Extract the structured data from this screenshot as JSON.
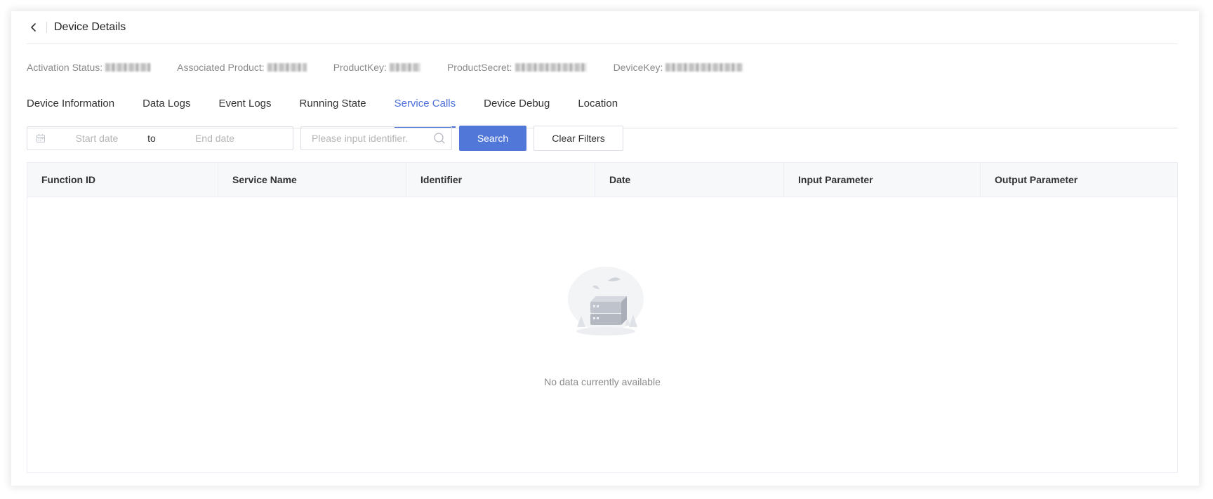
{
  "header": {
    "title": "Device Details"
  },
  "props": [
    {
      "label": "Activation Status:"
    },
    {
      "label": "Associated Product:"
    },
    {
      "label": "ProductKey:"
    },
    {
      "label": "ProductSecret:"
    },
    {
      "label": "DeviceKey:"
    }
  ],
  "tabs": [
    {
      "label": "Device Information",
      "active": false
    },
    {
      "label": "Data Logs",
      "active": false
    },
    {
      "label": "Event Logs",
      "active": false
    },
    {
      "label": "Running State",
      "active": false
    },
    {
      "label": "Service Calls",
      "active": true
    },
    {
      "label": "Device Debug",
      "active": false
    },
    {
      "label": "Location",
      "active": false
    }
  ],
  "filters": {
    "start_placeholder": "Start date",
    "range_separator": "to",
    "end_placeholder": "End date",
    "identifier_placeholder": "Please input identifier.",
    "search_label": "Search",
    "clear_label": "Clear Filters"
  },
  "table": {
    "columns": [
      "Function ID",
      "Service Name",
      "Identifier",
      "Date",
      "Input Parameter",
      "Output Parameter"
    ],
    "empty_text": "No data currently available"
  },
  "icons": {
    "back": "chevron-left-icon",
    "calendar": "calendar-icon",
    "search": "search-icon",
    "empty": "empty-data-illustration"
  },
  "colors": {
    "accent": "#4e71d9",
    "primary_button": "#5177d8",
    "table_header_bg": "#f7f8fa",
    "muted_text": "#8a8a8a"
  }
}
